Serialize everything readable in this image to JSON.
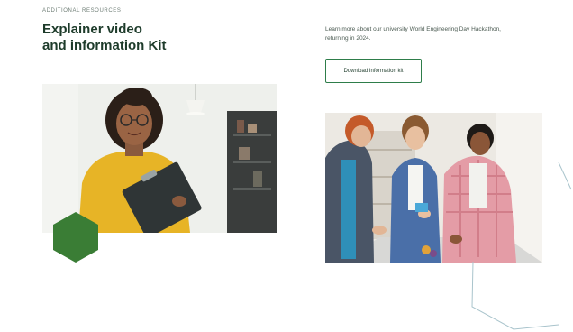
{
  "section": {
    "eyebrow": "ADDITIONAL RESOURCES",
    "title_line1": "Explainer video",
    "title_line2": "and information Kit",
    "description": "Learn more about our university World Engineering Day Hackathon, returning in 2024.",
    "download_label": "Download Information kit"
  },
  "colors": {
    "brand_green": "#2e7d4a",
    "hexagon_green": "#3a7d35",
    "heading": "#1d3b2a"
  },
  "icons": {
    "hexagon": "hexagon-shape",
    "decorative_lines": "outline-hexagon-lines"
  }
}
